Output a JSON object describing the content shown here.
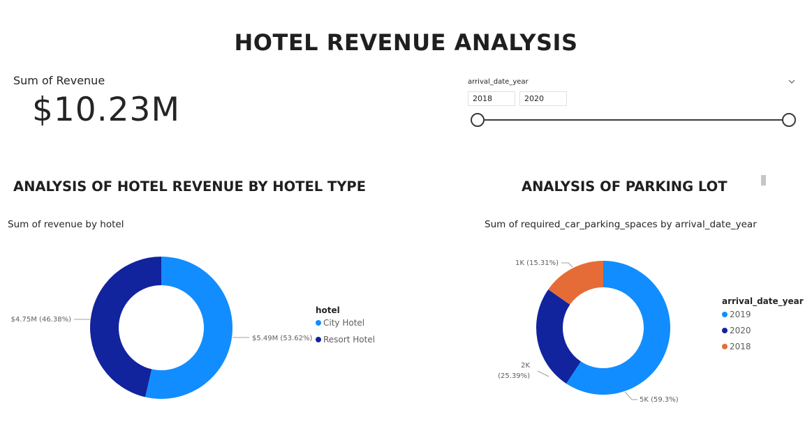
{
  "page": {
    "title": "HOTEL REVENUE ANALYSIS"
  },
  "card": {
    "label": "Sum of Revenue",
    "value": "$10.23M"
  },
  "slicer": {
    "label": "arrival_date_year",
    "start": "2018",
    "end": "2020",
    "range": [
      2018,
      2020
    ]
  },
  "sections": {
    "left_title": "ANALYSIS OF HOTEL REVENUE BY HOTEL TYPE",
    "right_title": "ANALYSIS OF PARKING LOT"
  },
  "chart_data": [
    {
      "type": "pie",
      "donut": true,
      "title": "Sum of revenue by hotel",
      "legend_title": "hotel",
      "legend_position": "right",
      "slices": [
        {
          "name": "City Hotel",
          "value": 5.49,
          "percent": 53.62,
          "label": "$5.49M (53.62%)",
          "color": "#118DFF"
        },
        {
          "name": "Resort Hotel",
          "value": 4.75,
          "percent": 46.38,
          "label": "$4.75M (46.38%)",
          "color": "#12239E"
        }
      ]
    },
    {
      "type": "pie",
      "donut": true,
      "title": "Sum of required_car_parking_spaces by arrival_date_year",
      "legend_title": "arrival_date_year",
      "legend_position": "right",
      "slices": [
        {
          "name": "2019",
          "value": 5000,
          "percent": 59.3,
          "label": "5K (59.3%)",
          "color": "#118DFF"
        },
        {
          "name": "2020",
          "value": 2000,
          "percent": 25.39,
          "label_lines": [
            "2K",
            "(25.39%)"
          ],
          "color": "#12239E"
        },
        {
          "name": "2018",
          "value": 1000,
          "percent": 15.31,
          "label": "1K (15.31%)",
          "color": "#E66C37"
        }
      ]
    }
  ]
}
